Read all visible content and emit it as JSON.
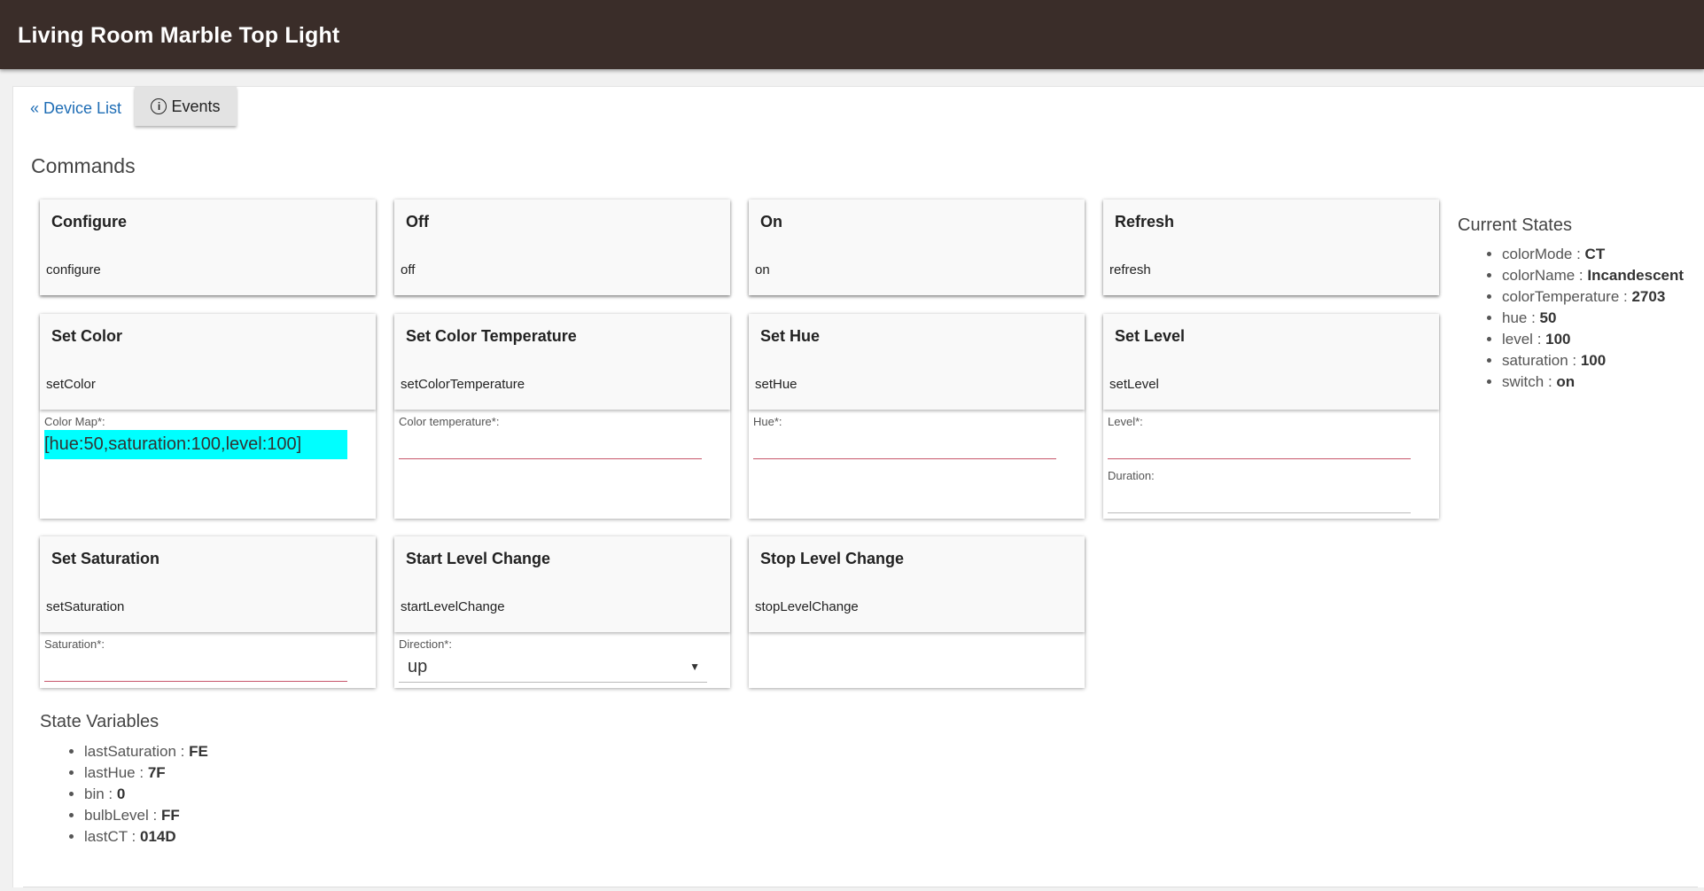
{
  "header": {
    "title": "Living Room Marble Top Light"
  },
  "nav": {
    "device_list_link": "« Device List",
    "events_button": "Events",
    "events_icon": "info-circle-icon"
  },
  "commands_title": "Commands",
  "commands": [
    {
      "name": "Configure",
      "method": "configure"
    },
    {
      "name": "Off",
      "method": "off"
    },
    {
      "name": "On",
      "method": "on"
    },
    {
      "name": "Refresh",
      "method": "refresh"
    },
    {
      "name": "Set Color",
      "method": "setColor",
      "field_label": "Color Map*:",
      "field_value": "[hue:50,saturation:100,level:100]"
    },
    {
      "name": "Set Color Temperature",
      "method": "setColorTemperature",
      "field_label": "Color temperature*:",
      "field_value": ""
    },
    {
      "name": "Set Hue",
      "method": "setHue",
      "field_label": "Hue*:",
      "field_value": ""
    },
    {
      "name": "Set Level",
      "method": "setLevel",
      "field_label": "Level*:",
      "field_value": "",
      "field2_label": "Duration:",
      "field2_value": ""
    },
    {
      "name": "Set Saturation",
      "method": "setSaturation",
      "field_label": "Saturation*:",
      "field_value": ""
    },
    {
      "name": "Start Level Change",
      "method": "startLevelChange",
      "field_label": "Direction*:",
      "field_value": "up"
    },
    {
      "name": "Stop Level Change",
      "method": "stopLevelChange"
    }
  ],
  "current_states": {
    "title": "Current States",
    "items": [
      {
        "key": "colorMode",
        "value": "CT"
      },
      {
        "key": "colorName",
        "value": "Incandescent"
      },
      {
        "key": "colorTemperature",
        "value": "2703"
      },
      {
        "key": "hue",
        "value": "50"
      },
      {
        "key": "level",
        "value": "100"
      },
      {
        "key": "saturation",
        "value": "100"
      },
      {
        "key": "switch",
        "value": "on"
      }
    ]
  },
  "state_variables": {
    "title": "State Variables",
    "items": [
      {
        "key": "lastSaturation",
        "value": "FE"
      },
      {
        "key": "lastHue",
        "value": "7F"
      },
      {
        "key": "bin",
        "value": "0"
      },
      {
        "key": "bulbLevel",
        "value": "FF"
      },
      {
        "key": "lastCT",
        "value": "014D"
      }
    ]
  },
  "colors": {
    "header_bg": "#3a2d29",
    "link": "#1e6db5",
    "highlight": "#00ffff",
    "input_underline": "#c7566b"
  }
}
